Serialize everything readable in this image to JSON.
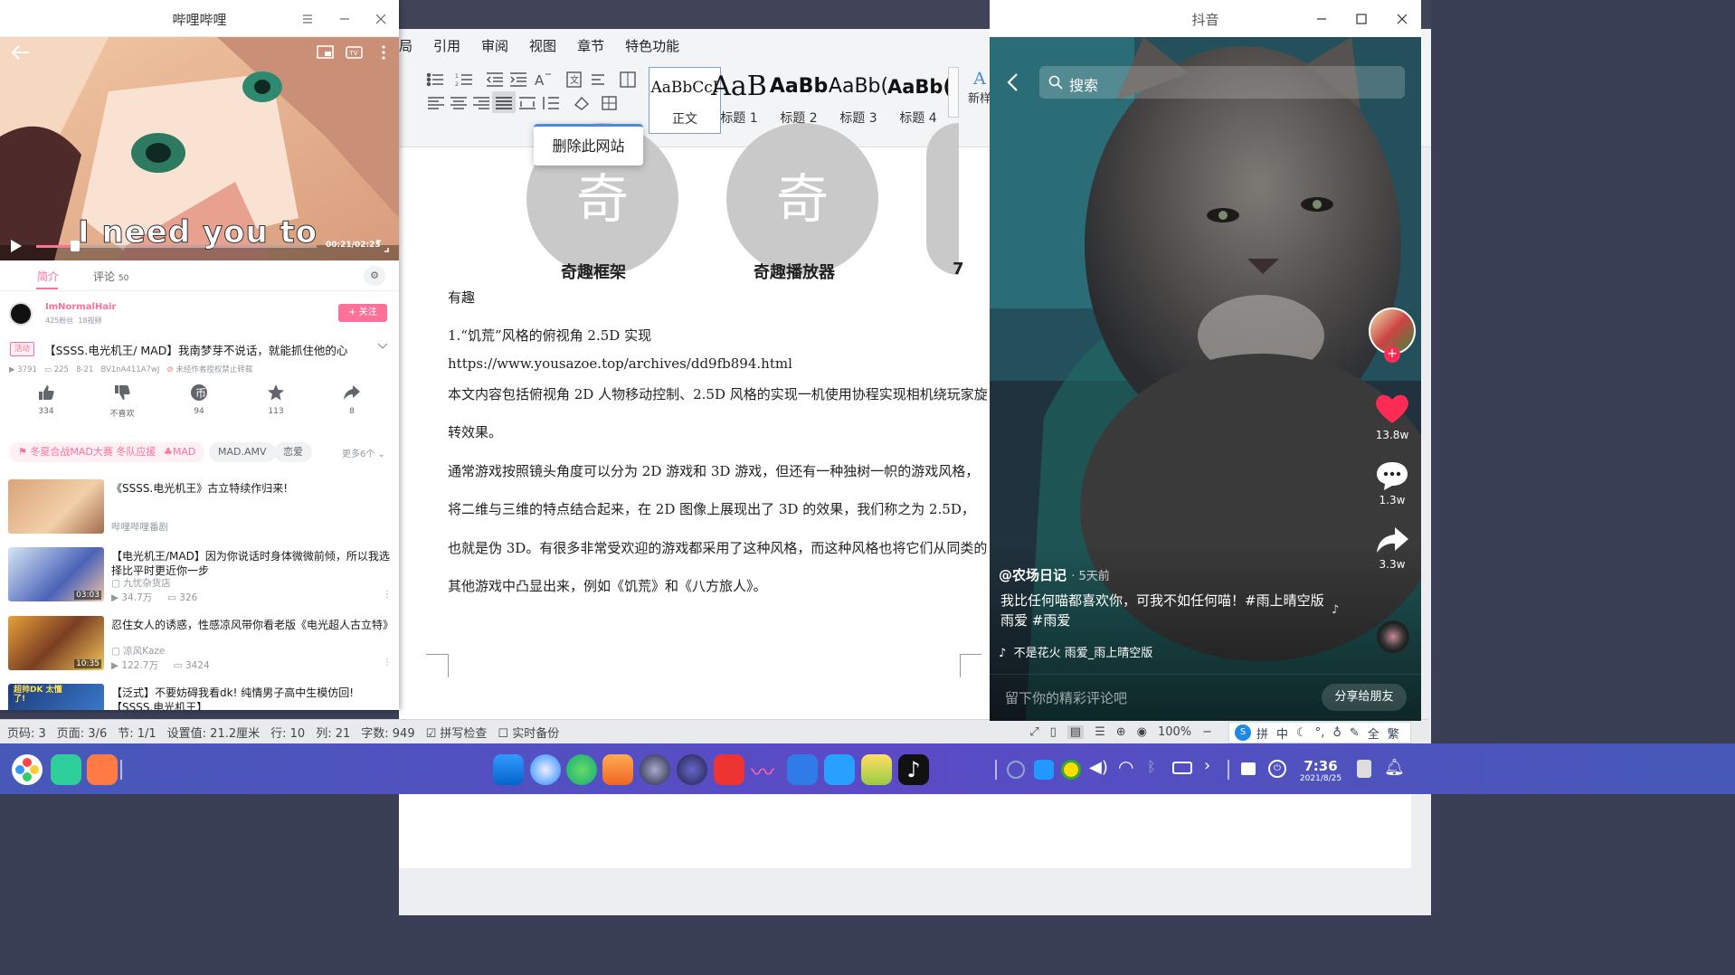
{
  "wps": {
    "tabs": [
      "局",
      "引用",
      "审阅",
      "视图",
      "章节",
      "特色功能"
    ],
    "styles": [
      {
        "sample": "AaBbCcI",
        "label": "正文"
      },
      {
        "sample": "AaB",
        "label": "标题 1"
      },
      {
        "sample": "AaBb",
        "label": "标题 2"
      },
      {
        "sample": "AaBb(",
        "label": "标题 3"
      },
      {
        "sample": "AaBb(",
        "label": "标题 4"
      }
    ],
    "new_style": "新样",
    "popup": "删除此网站",
    "circle_char": "奇",
    "apps": [
      "奇趣框架",
      "奇趣播放器",
      "7"
    ],
    "paragraphs": [
      "有趣",
      "1.“饥荒”风格的俯视角 2.5D 实现",
      "https://www.yousazoe.top/archives/dd9fb894.html",
      "本文内容包括俯视角 2D 人物移动控制、2.5D 风格的实现一机使用协程实现相机绕玩家旋",
      "转效果。",
      "通常游戏按照镜头角度可以分为 2D 游戏和 3D 游戏，但还有一种独树一帜的游戏风格，",
      "将二维与三维的特点结合起来，在 2D 图像上展现出了 3D 的效果，我们称之为 2.5D，",
      "也就是伪 3D。有很多非常受欢迎的游戏都采用了这种风格，而这种风格也将它们从同类的",
      "其他游戏中凸显出来，例如《饥荒》和《八方旅人》。"
    ],
    "status": {
      "page_no": "页码: 3",
      "pages": "页面: 3/6",
      "section": "节: 1/1",
      "setting": "设置值: 21.2厘米",
      "row": "行: 10",
      "col": "列: 21",
      "words": "字数: 949",
      "spell": "拼写检查",
      "backup": "实时备份",
      "zoom": "100%"
    }
  },
  "bili": {
    "title": "哔哩哔哩",
    "subtitle": "I need you to",
    "time": "00:21/02:23",
    "tabs": {
      "intro": "简介",
      "comments": "评论",
      "comment_count": "50"
    },
    "uploader": {
      "name": "ImNormalHair",
      "fans": "425粉丝",
      "videos": "18视频",
      "follow": "+ 关注"
    },
    "badge": "活动",
    "video_title": "【SSSS.电光机王/ MAD】我南梦芽不说话，就能抓住他的心",
    "stats": {
      "views": "3791",
      "danmaku": "225",
      "date": "8-21",
      "bvid": "BV1nA411A7wJ",
      "notice": "未经作者授权禁止转载"
    },
    "actions": [
      {
        "name": "like",
        "label": "334"
      },
      {
        "name": "dislike",
        "label": "不喜欢"
      },
      {
        "name": "coin",
        "label": "94"
      },
      {
        "name": "favorite",
        "label": "113"
      },
      {
        "name": "share",
        "label": "8"
      }
    ],
    "tags": [
      "冬夏合战MAD大赛 冬队应援",
      "MAD",
      "MAD.AMV",
      "恋爱"
    ],
    "more_tags": "更多6个",
    "related": [
      {
        "title": "《SSSS.电光机王》古立特续作归来!",
        "up": "哔哩哔哩番剧",
        "views": "",
        "danmaku": "",
        "duration": ""
      },
      {
        "title": "【电光机王/MAD】因为你说话时身体微微前倾，所以我选择比平时更近你一步",
        "up": "九忧杂货店",
        "views": "34.7万",
        "danmaku": "326",
        "duration": "03:03"
      },
      {
        "title": "忍住女人的诱惑，性感凉风带你看老版《电光超人古立特》",
        "up": "凉风Kaze",
        "views": "122.7万",
        "danmaku": "3424",
        "duration": "10:35"
      },
      {
        "title": "【泛式】不要妨碍我看dk! 纯情男子高中生模仿回! 【SSSS.电光机王】",
        "up": "",
        "views": "",
        "danmaku": "",
        "duration": "",
        "thumb_text": "超帅DK 太懂了!"
      }
    ]
  },
  "douyin": {
    "title": "抖音",
    "search_placeholder": "搜索",
    "likes": "13.8w",
    "comments": "1.3w",
    "shares": "3.3w",
    "author": "@农场日记",
    "time_ago": "· 5天前",
    "caption": "我比任何喵都喜欢你，可我不如任何喵！#雨上晴空版雨爱 #雨爱",
    "music": "不是花火  雨爱_雨上晴空版",
    "comment_placeholder": "留下你的精彩评论吧",
    "share_btn": "分享给朋友"
  },
  "taskbar": {
    "time": "7:36",
    "date": "2021/8/25",
    "ime": [
      "拼",
      "中",
      "全",
      "繁"
    ]
  },
  "colors": {
    "bili_pink": "#fb7299",
    "wps_blue": "#4e8ad9",
    "dy_red": "#fe2c55"
  }
}
